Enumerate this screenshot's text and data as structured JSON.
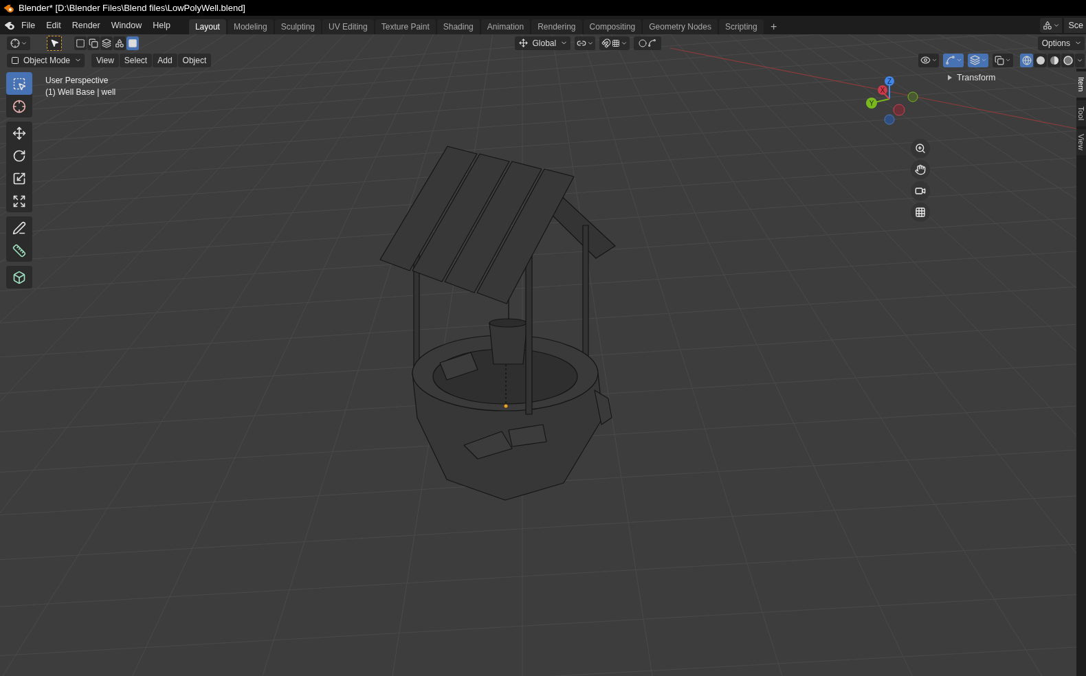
{
  "title": "Blender* [D:\\Blender Files\\Blend files\\LowPolyWell.blend]",
  "menu": [
    "File",
    "Edit",
    "Render",
    "Window",
    "Help"
  ],
  "workspaces": [
    {
      "label": "Layout",
      "selected": true
    },
    {
      "label": "Modeling",
      "selected": false
    },
    {
      "label": "Sculpting",
      "selected": false
    },
    {
      "label": "UV Editing",
      "selected": false
    },
    {
      "label": "Texture Paint",
      "selected": false
    },
    {
      "label": "Shading",
      "selected": false
    },
    {
      "label": "Animation",
      "selected": false
    },
    {
      "label": "Rendering",
      "selected": false
    },
    {
      "label": "Compositing",
      "selected": false
    },
    {
      "label": "Geometry Nodes",
      "selected": false
    },
    {
      "label": "Scripting",
      "selected": false
    }
  ],
  "add_workspace": "+",
  "scene": "Sce",
  "select_modes": [
    {
      "kind": "set",
      "selected": false
    },
    {
      "kind": "extend",
      "selected": false
    },
    {
      "kind": "subtract",
      "selected": false
    },
    {
      "kind": "difference",
      "selected": false
    },
    {
      "kind": "intersect",
      "selected": true
    }
  ],
  "orientation": "Global",
  "options": "Options",
  "mode": "Object Mode",
  "view_menus": [
    "View",
    "Select",
    "Add",
    "Object"
  ],
  "viewport_toggles": [
    {
      "kind": "visibility",
      "on": false
    },
    {
      "kind": "gizmos",
      "on": true
    },
    {
      "kind": "overlays",
      "on": true
    },
    {
      "kind": "xray",
      "on": false
    }
  ],
  "shading": [
    {
      "kind": "wireframe",
      "selected": true
    },
    {
      "kind": "solid",
      "selected": false
    },
    {
      "kind": "material",
      "selected": false
    },
    {
      "kind": "rendered",
      "selected": false
    }
  ],
  "tool_groups": [
    {
      "tools": [
        {
          "kind": "select",
          "selected": true
        },
        {
          "kind": "cursor",
          "selected": false
        }
      ]
    },
    {
      "tools": [
        {
          "kind": "move",
          "selected": false
        },
        {
          "kind": "rotate",
          "selected": false
        },
        {
          "kind": "scale",
          "selected": false
        },
        {
          "kind": "transform",
          "selected": false
        }
      ]
    },
    {
      "tools": [
        {
          "kind": "annotate",
          "selected": false
        },
        {
          "kind": "measure",
          "selected": false
        }
      ]
    },
    {
      "tools": [
        {
          "kind": "add_cube",
          "selected": false
        }
      ]
    }
  ],
  "viewport_info": [
    "User Perspective",
    "(1) Well Base | well"
  ],
  "gizmo_axes": {
    "z": "Z",
    "x": "X",
    "y": "Y"
  },
  "nav_buttons": [
    {
      "kind": "zoom"
    },
    {
      "kind": "pan"
    },
    {
      "kind": "camera"
    },
    {
      "kind": "ortho"
    }
  ],
  "transform_panel": {
    "title": "Transform",
    "expanded": false
  },
  "sidebar_tabs": [
    {
      "label": "Item",
      "selected": true
    },
    {
      "label": "Tool",
      "selected": false
    },
    {
      "label": "View",
      "selected": false
    }
  ]
}
